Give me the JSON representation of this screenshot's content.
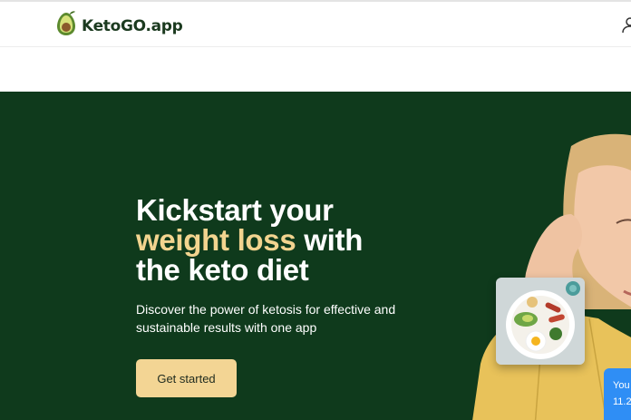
{
  "header": {
    "logo_text_main": "Keto",
    "logo_text_go": "GO",
    "logo_text_suffix": ".app",
    "logo_icon": "avocado-icon",
    "user_icon": "user-icon"
  },
  "hero": {
    "headline_line1": "Kickstart your",
    "headline_accent": "weight loss",
    "headline_line2_rest": " with",
    "headline_line3": "the keto diet",
    "subtext": "Discover the power of ketosis for effective and sustainable results with one app",
    "cta_label": "Get started",
    "chat_card_line1": "You",
    "chat_card_line2": "11.2"
  },
  "colors": {
    "hero_bg": "#0f3a1c",
    "accent": "#f2d48f",
    "cta_bg": "#f3d594",
    "chat_card": "#2f8ef5"
  }
}
